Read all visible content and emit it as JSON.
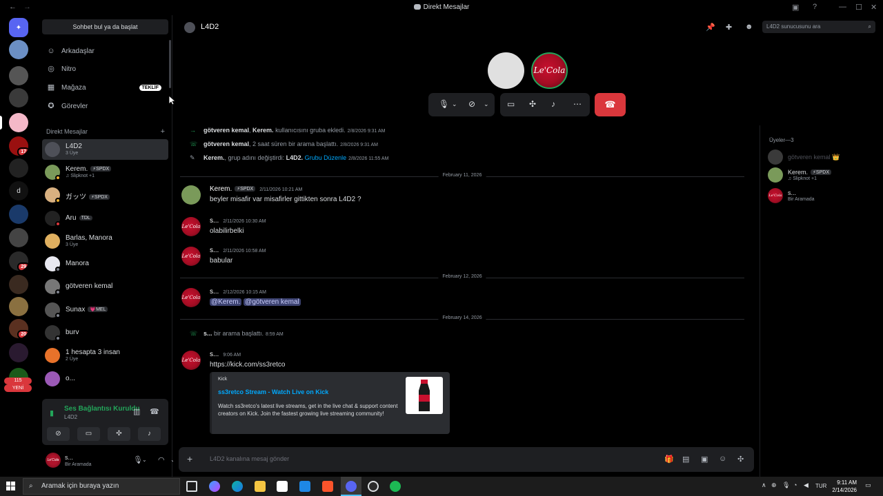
{
  "window": {
    "title": "Direkt Mesajlar"
  },
  "servers": {
    "badges": [
      "17",
      "29",
      "20",
      "115"
    ],
    "new_label": "YENİ",
    "letter_server": "d"
  },
  "dm_sidebar": {
    "search_placeholder": "Sohbet bul ya da başlat",
    "nav": [
      {
        "label": "Arkadaşlar",
        "icon": "friends-icon"
      },
      {
        "label": "Nitro",
        "icon": "nitro-icon"
      },
      {
        "label": "Mağaza",
        "icon": "shop-icon",
        "tag": "TEKLİF"
      },
      {
        "label": "Görevler",
        "icon": "quests-icon"
      }
    ],
    "section_title": "Direkt Mesajlar",
    "conversations": [
      {
        "name": "L4D2",
        "sub": "3 Üye",
        "selected": true
      },
      {
        "name": "Kerem.",
        "chip": "⚡SPDX",
        "sub": "♫ Slipknot +1"
      },
      {
        "name": "ガッツ",
        "chip": "⚡SPDX",
        "sub": ""
      },
      {
        "name": "Aru",
        "chip": "TDL",
        "sub": ""
      },
      {
        "name": "Barlas, Manora",
        "sub": "3 Üye"
      },
      {
        "name": "Manora",
        "sub": ""
      },
      {
        "name": "götveren kemal",
        "sub": ""
      },
      {
        "name": "Sunax",
        "chip": "💗MEL",
        "sub": ""
      },
      {
        "name": "burv",
        "sub": ""
      },
      {
        "name": "1 hesapta 3 insan",
        "sub": "2 Üye"
      },
      {
        "name": "o...",
        "sub": ""
      }
    ],
    "voice": {
      "status": "Ses Bağlantısı Kuruldu",
      "channel": "L4D2"
    },
    "user": {
      "name": "s...",
      "status": "Bir Aramada"
    }
  },
  "header": {
    "channel": "L4D2",
    "search_placeholder": "L4D2 sunucusunu ara"
  },
  "call": {
    "avatar_text": "Le'Cola"
  },
  "messages": {
    "system": [
      {
        "actor": "götveren kemal",
        "text_a": ", ",
        "actor2": "Kerem.",
        "text_b": " kullanıcısını gruba ekledi.",
        "time": "2/8/2026 9:31 AM"
      },
      {
        "actor": "götveren kemal",
        "text_a": ", 2 saat süren bir arama başlattı.",
        "time": "2/8/2026 9:31 AM"
      },
      {
        "actor": "Kerem.",
        "text_a": ", grup adını değiştirdi: ",
        "actor2": "L4D2.",
        "link": "Grubu Düzenle",
        "time": "2/8/2026 11:55 AM"
      }
    ],
    "dividers": [
      "February 11, 2026",
      "February 12, 2026",
      "February 14, 2026"
    ],
    "m1": {
      "author": "Kerem.",
      "chip": "⚡SPDX",
      "time": "2/11/2026 10:21 AM",
      "text": "beyler misafir var misafirler gittikten sonra L4D2 ?"
    },
    "m2": {
      "author": "s...",
      "time": "2/11/2026 10:30 AM",
      "text": "olabilirbelki"
    },
    "m3": {
      "author": "s...",
      "time": "2/11/2026 10:58 AM",
      "text": "babular"
    },
    "m4": {
      "author": "s...",
      "time": "2/12/2026 10:15 AM",
      "mention1": "@Kerem.",
      "mention2": "@götveren kemal"
    },
    "sys4": {
      "actor": "s...",
      "text": " bir arama başlattı.",
      "time": "8:59 AM"
    },
    "m5": {
      "author": "s...",
      "time": "9:06 AM",
      "link": "https://kick.com/ss3retco"
    },
    "embed": {
      "provider": "Kick",
      "title": "ss3retco Stream - Watch Live on Kick",
      "description": "Watch ss3retco's latest live streams, get in the live chat & support content creators on Kick. Join the fastest growing live streaming community!"
    }
  },
  "composer": {
    "placeholder": "L4D2 kanalına mesaj gönder"
  },
  "members": {
    "header": "Üyeler—3",
    "list": [
      {
        "name": "götveren kemal 👑",
        "sub": "",
        "faded": true
      },
      {
        "name": "Kerem.",
        "chip": "⚡SPDX",
        "sub": "♫ Slipknot +1"
      },
      {
        "name": "s...",
        "sub": "Bir Aramada"
      }
    ]
  },
  "taskbar": {
    "search_placeholder": "Aramak için buraya yazın",
    "lang": "TUR",
    "time": "9:11 AM",
    "date": "2/14/2026"
  },
  "colors": {
    "accent_green": "#23a55a",
    "hangup_red": "#da373c",
    "link_blue": "#00a8fc",
    "panel": "#1e1f22"
  }
}
